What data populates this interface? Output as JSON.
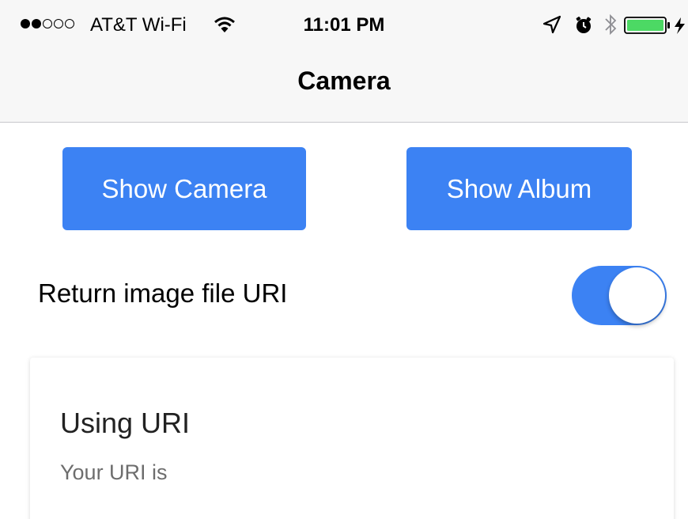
{
  "status_bar": {
    "carrier": "AT&T Wi-Fi",
    "time": "11:01 PM",
    "signal_bars_filled": 2,
    "signal_bars_total": 5,
    "battery_color": "#4cd964",
    "icons": [
      "wifi-icon",
      "location-icon",
      "alarm-icon",
      "bluetooth-icon",
      "battery-icon",
      "charging-icon"
    ]
  },
  "nav": {
    "title": "Camera"
  },
  "buttons": {
    "show_camera": "Show Camera",
    "show_album": "Show Album"
  },
  "toggle": {
    "label": "Return image file URI",
    "on": true
  },
  "card": {
    "title": "Using URI",
    "subtitle": "Your URI is"
  },
  "colors": {
    "accent": "#3c82f3",
    "nav_background": "#f7f7f7"
  }
}
